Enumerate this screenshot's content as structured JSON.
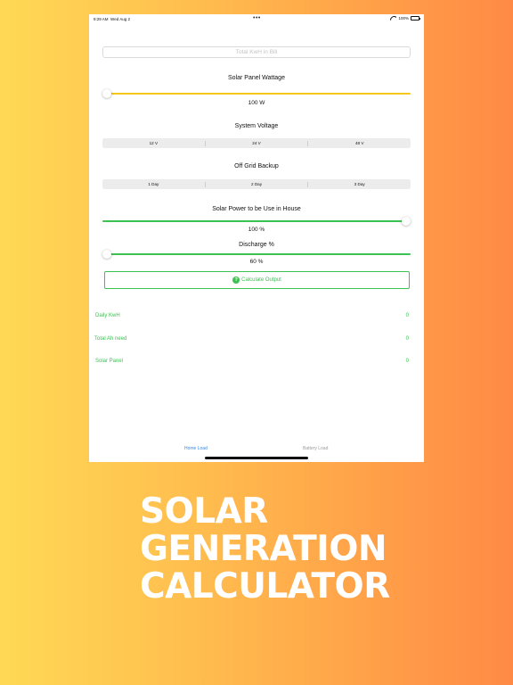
{
  "status_bar": {
    "time": "9:29 AM",
    "date": "Wed Aug 2",
    "dots": "•••",
    "battery_percent": "100%"
  },
  "kwh_input": {
    "placeholder": "Total KwH in Bill",
    "value": ""
  },
  "solar_panel": {
    "title": "Solar Panel Wattage",
    "value_text": "100 W",
    "slider_fraction": 0.0,
    "track_color": "#f5c518"
  },
  "system_voltage": {
    "title": "System Voltage",
    "options": [
      "12 V",
      "24 V",
      "48 V"
    ]
  },
  "off_grid": {
    "title": "Off Grid Backup",
    "options": [
      "1 Day",
      "2 Day",
      "3 Day"
    ]
  },
  "house_power": {
    "title": "Solar Power to be Use in House",
    "value_text": "100 %",
    "slider_fraction": 1.0,
    "track_color": "#3cc252"
  },
  "discharge": {
    "title": "Discharge %",
    "value_text": "60 %",
    "slider_fraction": 0.0,
    "track_color": "#3cc252"
  },
  "calculate_button": {
    "icon": "question-circle-icon",
    "label": "Calculate Output"
  },
  "results": [
    {
      "label": "Daily KwH",
      "value": "0"
    },
    {
      "label": "Total Ah need",
      "value": "0"
    },
    {
      "label": "Solar Panel",
      "value": "0"
    }
  ],
  "tabs": [
    "Home Load",
    "Battery Load"
  ],
  "colors": {
    "accent_green": "#3cc252",
    "accent_yellow": "#f5c518",
    "tab_active": "#3a89e0",
    "tab_inactive": "#9c9c9c"
  },
  "promo": {
    "lines": [
      "SOLAR",
      "GENERATION",
      "CALCULATOR"
    ]
  }
}
